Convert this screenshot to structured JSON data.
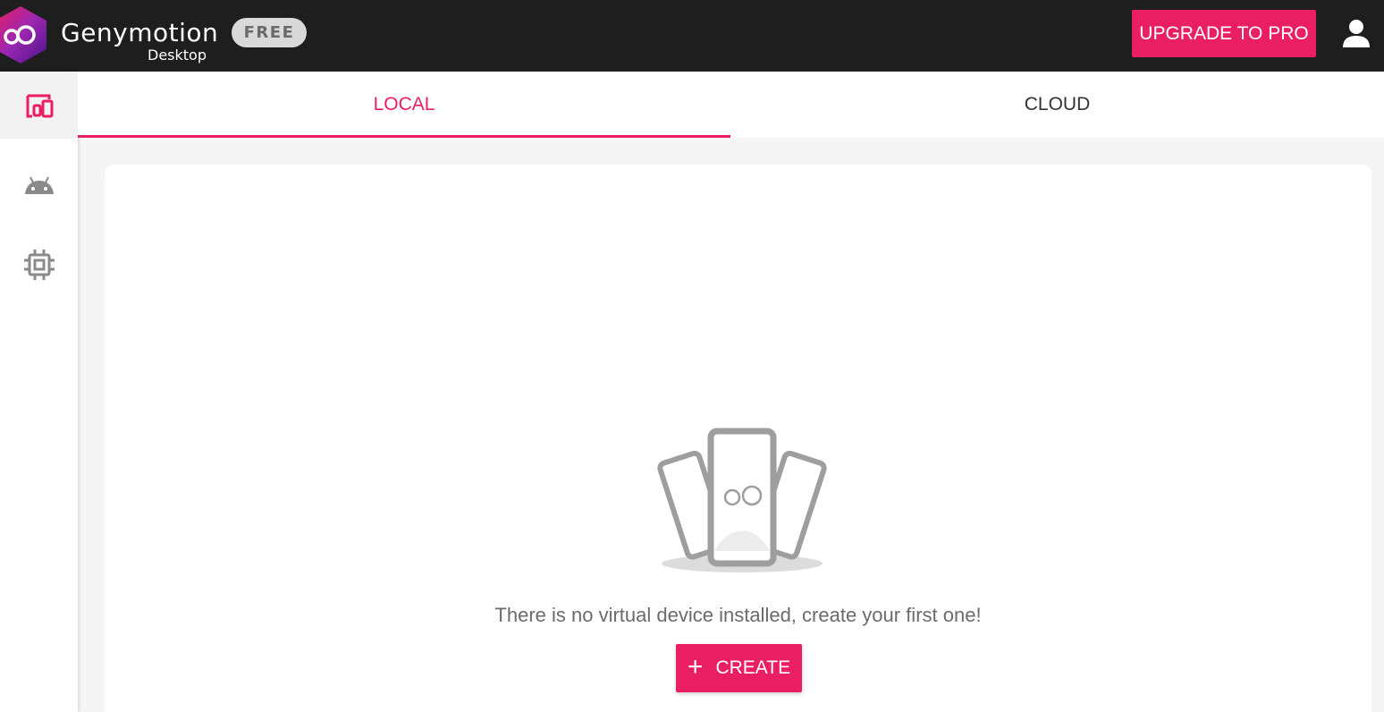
{
  "app": {
    "brand_name": "Genymotion",
    "brand_sub": "Desktop",
    "plan_badge": "FREE"
  },
  "header": {
    "upgrade_label": "UPGRADE TO PRO",
    "account_icon": "account-icon"
  },
  "sidebar": {
    "items": [
      {
        "icon": "devices-icon",
        "active": true
      },
      {
        "icon": "android-icon",
        "active": false
      },
      {
        "icon": "chip-icon",
        "active": false
      }
    ]
  },
  "tabs": [
    {
      "label": "LOCAL",
      "active": true
    },
    {
      "label": "CLOUD",
      "active": false
    }
  ],
  "main": {
    "empty_message": "There is no virtual device installed, create your first one!",
    "create_label": "CREATE",
    "create_icon": "plus-icon"
  },
  "colors": {
    "accent": "#e91e63",
    "topbar": "#1e1e1e",
    "background": "#f5f5f5"
  }
}
